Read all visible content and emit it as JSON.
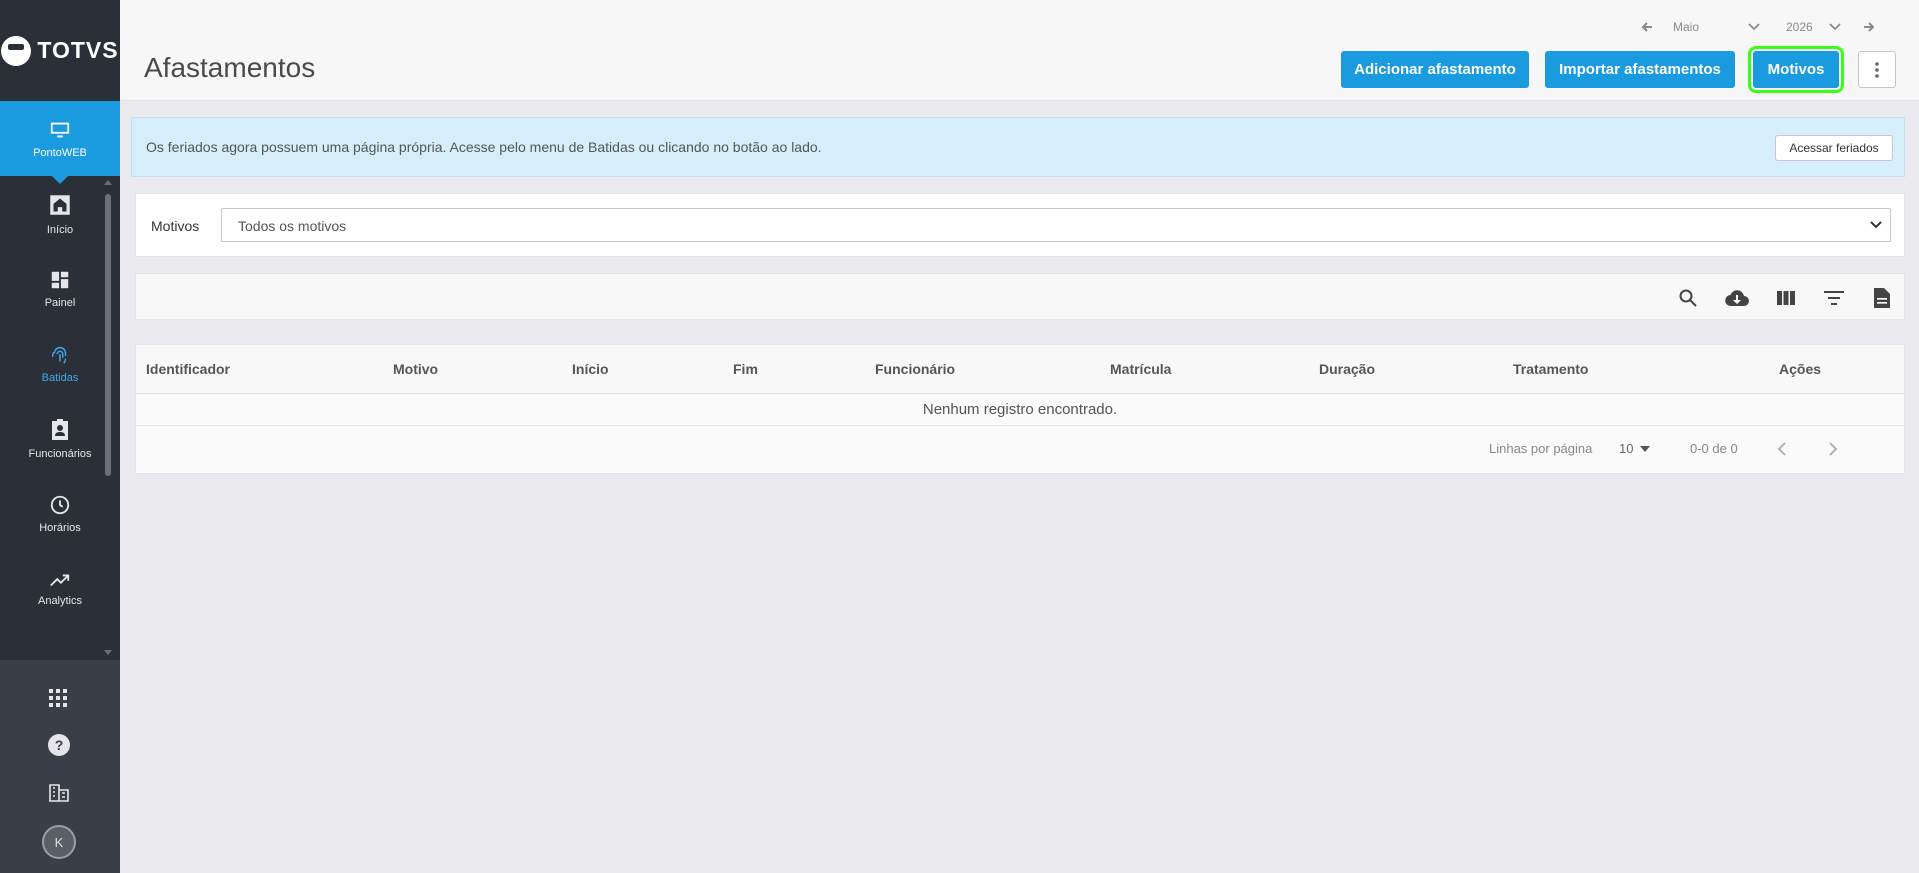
{
  "brand": {
    "name": "TOTVS"
  },
  "app": {
    "label": "PontoWEB"
  },
  "nav": [
    {
      "label": "Início",
      "icon": "home-icon"
    },
    {
      "label": "Painel",
      "icon": "dashboard-icon"
    },
    {
      "label": "Batidas",
      "icon": "fingerprint-icon",
      "active": true
    },
    {
      "label": "Funcionários",
      "icon": "badge-icon"
    },
    {
      "label": "Horários",
      "icon": "clock-icon"
    },
    {
      "label": "Analytics",
      "icon": "trending-up-icon"
    }
  ],
  "user": {
    "initial": "K"
  },
  "header": {
    "title": "Afastamentos",
    "month": "Maio",
    "year": "2026",
    "add_label": "Adicionar afastamento",
    "import_label": "Importar afastamentos",
    "reasons_label": "Motivos"
  },
  "banner": {
    "text": "Os feriados agora possuem uma página própria. Acesse pelo menu de Batidas ou clicando no botão ao lado.",
    "button": "Acessar feriados"
  },
  "filter": {
    "label": "Motivos",
    "value": "Todos os motivos"
  },
  "table": {
    "columns": [
      "Identificador",
      "Motivo",
      "Início",
      "Fim",
      "Funcionário",
      "Matrícula",
      "Duração",
      "Tratamento",
      "Ações"
    ],
    "empty": "Nenhum registro encontrado.",
    "rows_per_page_label": "Linhas por página",
    "rows_per_page": "10",
    "range": "0-0 de 0"
  },
  "colors": {
    "primary": "#1a9be0",
    "sidebar": "#2b2f38",
    "highlight": "#39ff14"
  }
}
